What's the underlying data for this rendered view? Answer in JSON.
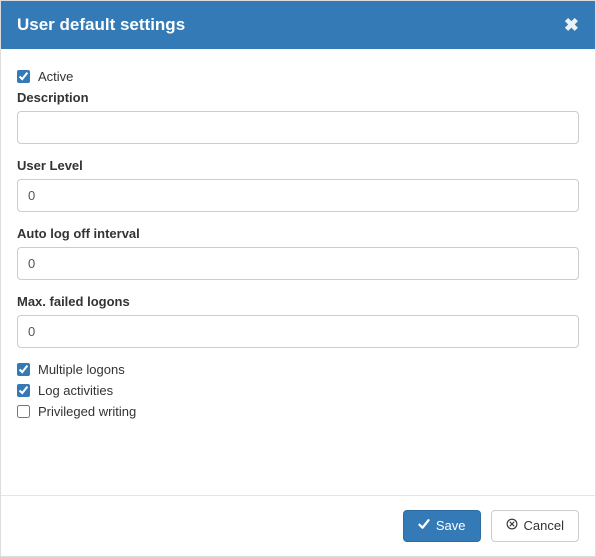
{
  "header": {
    "title": "User default settings"
  },
  "form": {
    "active": {
      "label": "Active",
      "checked": true
    },
    "description": {
      "label": "Description",
      "value": ""
    },
    "user_level": {
      "label": "User Level",
      "value": "0"
    },
    "auto_logoff": {
      "label": "Auto log off interval",
      "value": "0"
    },
    "max_failed": {
      "label": "Max. failed logons",
      "value": "0"
    },
    "multiple_logons": {
      "label": "Multiple logons",
      "checked": true
    },
    "log_activities": {
      "label": "Log activities",
      "checked": true
    },
    "privileged_writing": {
      "label": "Privileged writing",
      "checked": false
    }
  },
  "footer": {
    "save_label": "Save",
    "cancel_label": "Cancel"
  }
}
